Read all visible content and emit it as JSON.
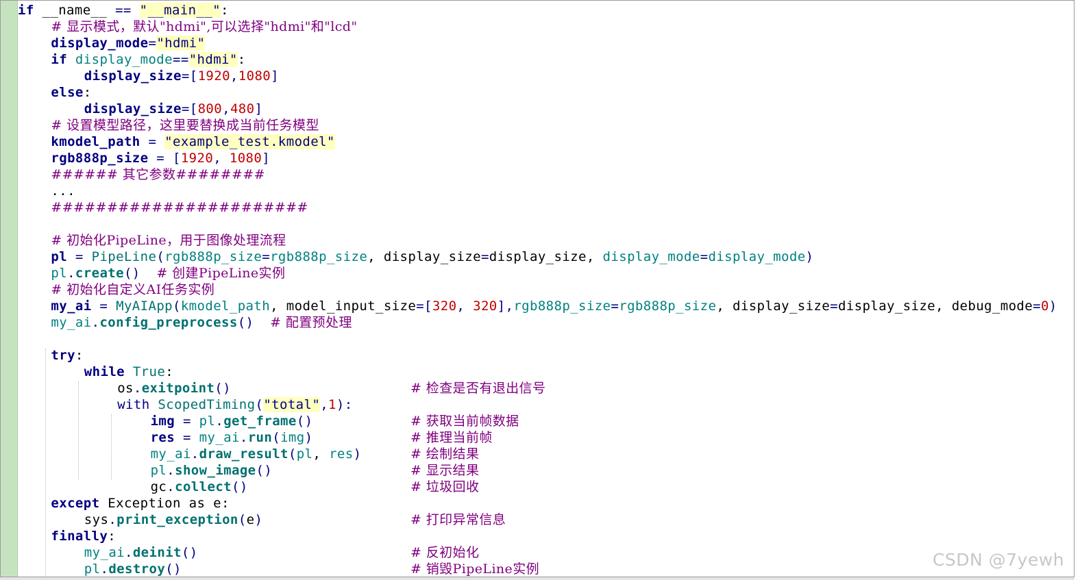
{
  "watermark": "CSDN @7yewh",
  "lines": [
    {
      "indent": 0,
      "tokens": [
        {
          "t": "if",
          "c": "kw"
        },
        {
          "t": " __name__ ",
          "c": "plain"
        },
        {
          "t": "==",
          "c": "op"
        },
        {
          "t": " ",
          "c": "plain"
        },
        {
          "t": "\"__main__\"",
          "c": "str"
        },
        {
          "t": ":",
          "c": "plain"
        }
      ]
    },
    {
      "indent": 2,
      "tokens": [
        {
          "t": "# 显示模式，默认\"hdmi\",可以选择\"hdmi\"和\"lcd\"",
          "c": "com"
        }
      ]
    },
    {
      "indent": 2,
      "tokens": [
        {
          "t": "display_mode",
          "c": "id"
        },
        {
          "t": "=",
          "c": "op"
        },
        {
          "t": "\"hdmi\"",
          "c": "str"
        }
      ]
    },
    {
      "indent": 2,
      "tokens": [
        {
          "t": "if",
          "c": "kw"
        },
        {
          "t": " ",
          "c": "plain"
        },
        {
          "t": "display_mode",
          "c": "attr"
        },
        {
          "t": "==",
          "c": "op"
        },
        {
          "t": "\"hdmi\"",
          "c": "str"
        },
        {
          "t": ":",
          "c": "plain"
        }
      ]
    },
    {
      "indent": 4,
      "tokens": [
        {
          "t": "display_size",
          "c": "id"
        },
        {
          "t": "=[",
          "c": "op"
        },
        {
          "t": "1920",
          "c": "num"
        },
        {
          "t": ",",
          "c": "op"
        },
        {
          "t": "1080",
          "c": "num"
        },
        {
          "t": "]",
          "c": "op"
        }
      ]
    },
    {
      "indent": 2,
      "tokens": [
        {
          "t": "else",
          "c": "kw"
        },
        {
          "t": ":",
          "c": "plain"
        }
      ]
    },
    {
      "indent": 4,
      "tokens": [
        {
          "t": "display_size",
          "c": "id"
        },
        {
          "t": "=[",
          "c": "op"
        },
        {
          "t": "800",
          "c": "num"
        },
        {
          "t": ",",
          "c": "op"
        },
        {
          "t": "480",
          "c": "num"
        },
        {
          "t": "]",
          "c": "op"
        }
      ]
    },
    {
      "indent": 2,
      "tokens": [
        {
          "t": "# 设置模型路径，这里要替换成当前任务模型",
          "c": "com"
        }
      ]
    },
    {
      "indent": 2,
      "tokens": [
        {
          "t": "kmodel_path",
          "c": "id"
        },
        {
          "t": " = ",
          "c": "op"
        },
        {
          "t": "\"example_test.kmodel\"",
          "c": "str"
        }
      ]
    },
    {
      "indent": 2,
      "tokens": [
        {
          "t": "rgb888p_size",
          "c": "id"
        },
        {
          "t": " = [",
          "c": "op"
        },
        {
          "t": "1920",
          "c": "num"
        },
        {
          "t": ", ",
          "c": "op"
        },
        {
          "t": "1080",
          "c": "num"
        },
        {
          "t": "]",
          "c": "op"
        }
      ]
    },
    {
      "indent": 2,
      "tokens": [
        {
          "t": "###### 其它参数########",
          "c": "com"
        }
      ]
    },
    {
      "indent": 2,
      "tokens": [
        {
          "t": "...",
          "c": "plain"
        }
      ]
    },
    {
      "indent": 2,
      "tokens": [
        {
          "t": "#######################",
          "c": "com"
        }
      ]
    },
    {
      "indent": 0,
      "tokens": []
    },
    {
      "indent": 2,
      "tokens": [
        {
          "t": "# 初始化PipeLine，用于图像处理流程",
          "c": "com"
        }
      ]
    },
    {
      "indent": 2,
      "tokens": [
        {
          "t": "pl",
          "c": "id"
        },
        {
          "t": " = ",
          "c": "op"
        },
        {
          "t": "PipeLine",
          "c": "class"
        },
        {
          "t": "(",
          "c": "op"
        },
        {
          "t": "rgb888p_size",
          "c": "attr"
        },
        {
          "t": "=",
          "c": "op"
        },
        {
          "t": "rgb888p_size",
          "c": "attr"
        },
        {
          "t": ", ",
          "c": "plain"
        },
        {
          "t": "display_size",
          "c": "idn"
        },
        {
          "t": "=",
          "c": "op"
        },
        {
          "t": "display_size",
          "c": "idn"
        },
        {
          "t": ", ",
          "c": "plain"
        },
        {
          "t": "display_mode",
          "c": "attr"
        },
        {
          "t": "=",
          "c": "op"
        },
        {
          "t": "display_mode",
          "c": "attr"
        },
        {
          "t": ")",
          "c": "op"
        }
      ]
    },
    {
      "indent": 2,
      "tokens": [
        {
          "t": "pl",
          "c": "attr"
        },
        {
          "t": ".",
          "c": "op"
        },
        {
          "t": "create",
          "c": "func"
        },
        {
          "t": "()",
          "c": "op"
        },
        {
          "t": "  ",
          "c": "plain"
        },
        {
          "t": "# 创建PipeLine实例",
          "c": "com"
        }
      ]
    },
    {
      "indent": 2,
      "tokens": [
        {
          "t": "# 初始化自定义AI任务实例",
          "c": "com"
        }
      ]
    },
    {
      "indent": 2,
      "tokens": [
        {
          "t": "my_ai",
          "c": "id"
        },
        {
          "t": " = ",
          "c": "op"
        },
        {
          "t": "MyAIApp",
          "c": "class"
        },
        {
          "t": "(",
          "c": "op"
        },
        {
          "t": "kmodel_path",
          "c": "attr"
        },
        {
          "t": ", ",
          "c": "plain"
        },
        {
          "t": "model_input_size",
          "c": "idn"
        },
        {
          "t": "=[",
          "c": "op"
        },
        {
          "t": "320",
          "c": "num"
        },
        {
          "t": ", ",
          "c": "op"
        },
        {
          "t": "320",
          "c": "num"
        },
        {
          "t": "],",
          "c": "op"
        },
        {
          "t": "rgb888p_size",
          "c": "attr"
        },
        {
          "t": "=",
          "c": "op"
        },
        {
          "t": "rgb888p_size",
          "c": "attr"
        },
        {
          "t": ", ",
          "c": "plain"
        },
        {
          "t": "display_size",
          "c": "idn"
        },
        {
          "t": "=",
          "c": "op"
        },
        {
          "t": "display_size",
          "c": "idn"
        },
        {
          "t": ", ",
          "c": "plain"
        },
        {
          "t": "debug_mode",
          "c": "idn"
        },
        {
          "t": "=",
          "c": "op"
        },
        {
          "t": "0",
          "c": "num"
        },
        {
          "t": ")",
          "c": "op"
        }
      ]
    },
    {
      "indent": 2,
      "tokens": [
        {
          "t": "my_ai",
          "c": "attr"
        },
        {
          "t": ".",
          "c": "op"
        },
        {
          "t": "config_preprocess",
          "c": "func"
        },
        {
          "t": "()",
          "c": "op"
        },
        {
          "t": "  ",
          "c": "plain"
        },
        {
          "t": "# 配置预处理",
          "c": "com"
        }
      ]
    },
    {
      "indent": 0,
      "tokens": []
    },
    {
      "indent": 2,
      "tokens": [
        {
          "t": "try",
          "c": "kw"
        },
        {
          "t": ":",
          "c": "plain"
        }
      ]
    },
    {
      "indent": 4,
      "tokens": [
        {
          "t": "while",
          "c": "kw"
        },
        {
          "t": " ",
          "c": "plain"
        },
        {
          "t": "True",
          "c": "class"
        },
        {
          "t": ":",
          "c": "plain"
        }
      ]
    },
    {
      "indent": 6,
      "tokens": [
        {
          "t": "os",
          "c": "idn"
        },
        {
          "t": ".",
          "c": "op"
        },
        {
          "t": "exitpoint",
          "c": "func"
        },
        {
          "t": "()",
          "c": "op"
        }
      ],
      "comment": "# 检查是否有退出信号"
    },
    {
      "indent": 6,
      "tokens": [
        {
          "t": "with",
          "c": "kwn"
        },
        {
          "t": " ",
          "c": "plain"
        },
        {
          "t": "ScopedTiming",
          "c": "class"
        },
        {
          "t": "(",
          "c": "op"
        },
        {
          "t": "\"total\"",
          "c": "str"
        },
        {
          "t": ",",
          "c": "op"
        },
        {
          "t": "1",
          "c": "num"
        },
        {
          "t": "):",
          "c": "op"
        }
      ]
    },
    {
      "indent": 8,
      "tokens": [
        {
          "t": "img",
          "c": "id"
        },
        {
          "t": " = ",
          "c": "op"
        },
        {
          "t": "pl",
          "c": "attr"
        },
        {
          "t": ".",
          "c": "op"
        },
        {
          "t": "get_frame",
          "c": "func"
        },
        {
          "t": "()",
          "c": "op"
        }
      ],
      "comment": "# 获取当前帧数据"
    },
    {
      "indent": 8,
      "tokens": [
        {
          "t": "res",
          "c": "id"
        },
        {
          "t": " = ",
          "c": "op"
        },
        {
          "t": "my_ai",
          "c": "attr"
        },
        {
          "t": ".",
          "c": "op"
        },
        {
          "t": "run",
          "c": "func"
        },
        {
          "t": "(",
          "c": "op"
        },
        {
          "t": "img",
          "c": "attr"
        },
        {
          "t": ")",
          "c": "op"
        }
      ],
      "comment": "# 推理当前帧"
    },
    {
      "indent": 8,
      "tokens": [
        {
          "t": "my_ai",
          "c": "attr"
        },
        {
          "t": ".",
          "c": "op"
        },
        {
          "t": "draw_result",
          "c": "func"
        },
        {
          "t": "(",
          "c": "op"
        },
        {
          "t": "pl",
          "c": "attr"
        },
        {
          "t": ", ",
          "c": "plain"
        },
        {
          "t": "res",
          "c": "attr"
        },
        {
          "t": ")",
          "c": "op"
        }
      ],
      "comment": "# 绘制结果"
    },
    {
      "indent": 8,
      "tokens": [
        {
          "t": "pl",
          "c": "attr"
        },
        {
          "t": ".",
          "c": "op"
        },
        {
          "t": "show_image",
          "c": "func"
        },
        {
          "t": "()",
          "c": "op"
        }
      ],
      "comment": "# 显示结果"
    },
    {
      "indent": 8,
      "tokens": [
        {
          "t": "gc",
          "c": "idn"
        },
        {
          "t": ".",
          "c": "op"
        },
        {
          "t": "collect",
          "c": "func"
        },
        {
          "t": "()",
          "c": "op"
        }
      ],
      "comment": "# 垃圾回收"
    },
    {
      "indent": 2,
      "tokens": [
        {
          "t": "except",
          "c": "kw"
        },
        {
          "t": " Exception as e:",
          "c": "plain"
        }
      ]
    },
    {
      "indent": 4,
      "tokens": [
        {
          "t": "sys",
          "c": "idn"
        },
        {
          "t": ".",
          "c": "op"
        },
        {
          "t": "print_exception",
          "c": "func"
        },
        {
          "t": "(",
          "c": "op"
        },
        {
          "t": "e",
          "c": "idn"
        },
        {
          "t": ")",
          "c": "op"
        }
      ],
      "comment": "# 打印异常信息"
    },
    {
      "indent": 2,
      "tokens": [
        {
          "t": "finally",
          "c": "kw"
        },
        {
          "t": ":",
          "c": "plain"
        }
      ]
    },
    {
      "indent": 4,
      "tokens": [
        {
          "t": "my_ai",
          "c": "attr"
        },
        {
          "t": ".",
          "c": "op"
        },
        {
          "t": "deinit",
          "c": "func"
        },
        {
          "t": "()",
          "c": "op"
        }
      ],
      "comment": "# 反初始化"
    },
    {
      "indent": 4,
      "tokens": [
        {
          "t": "pl",
          "c": "attr"
        },
        {
          "t": ".",
          "c": "op"
        },
        {
          "t": "destroy",
          "c": "func"
        },
        {
          "t": "()",
          "c": "op"
        }
      ],
      "comment": "# 销毁PipeLine实例"
    }
  ]
}
